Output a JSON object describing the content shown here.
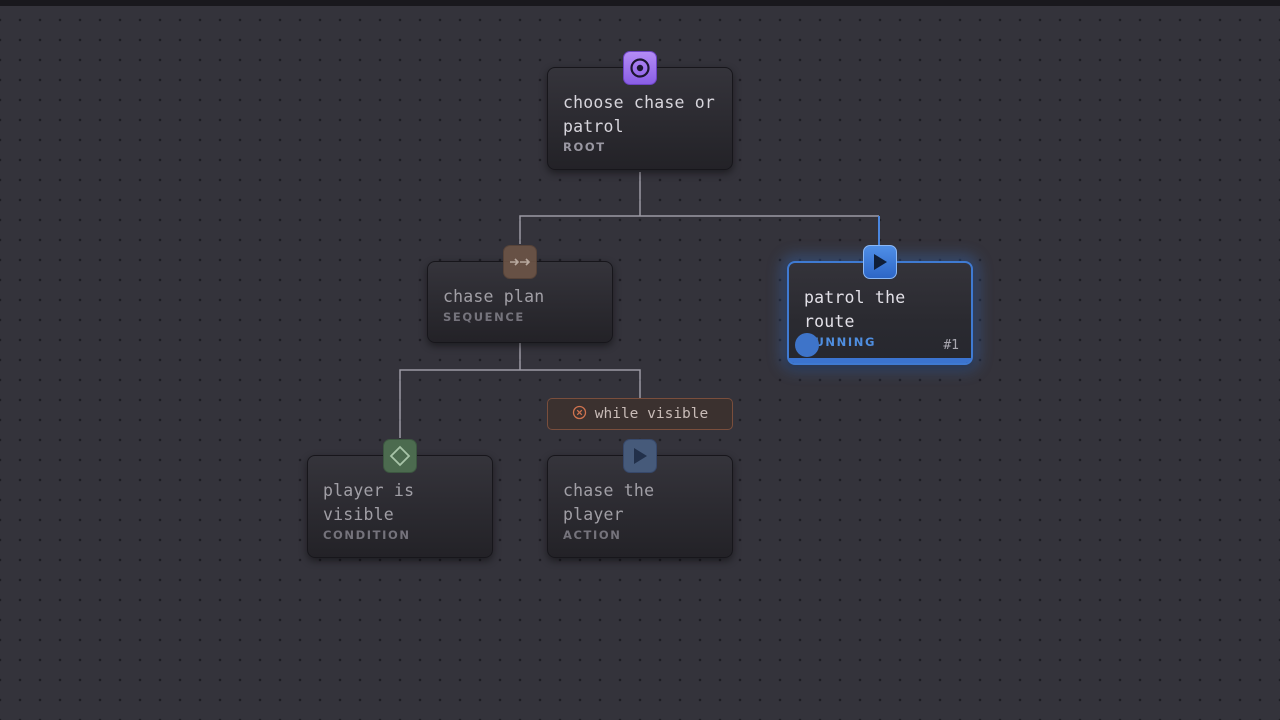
{
  "tree": {
    "nodes": [
      {
        "id": "root",
        "title": "choose chase or patrol",
        "kind": "ROOT",
        "icon": "target-icon"
      },
      {
        "id": "sequence",
        "title": "chase plan",
        "kind": "SEQUENCE",
        "icon": "sequence-arrows-icon"
      },
      {
        "id": "patrol",
        "title": "patrol the route",
        "kind": "RUNNING",
        "icon": "play-icon",
        "run_index": "#1",
        "progress": 1.0
      },
      {
        "id": "condition",
        "title": "player is visible",
        "kind": "CONDITION",
        "icon": "diamond-icon"
      },
      {
        "id": "chase",
        "title": "chase the player",
        "kind": "ACTION",
        "icon": "play-icon"
      }
    ],
    "decorator": {
      "label": "while visible",
      "icon": "cancel-circle-icon"
    }
  },
  "colors": {
    "canvas": "#34333b",
    "running_accent": "#3f7ad2",
    "root_badge": "#9b6ff0",
    "sequence_badge": "#6d5547",
    "condition_badge": "#4c6b4f",
    "action_badge": "#465a7a",
    "decorator_border": "#7a4e3c"
  }
}
